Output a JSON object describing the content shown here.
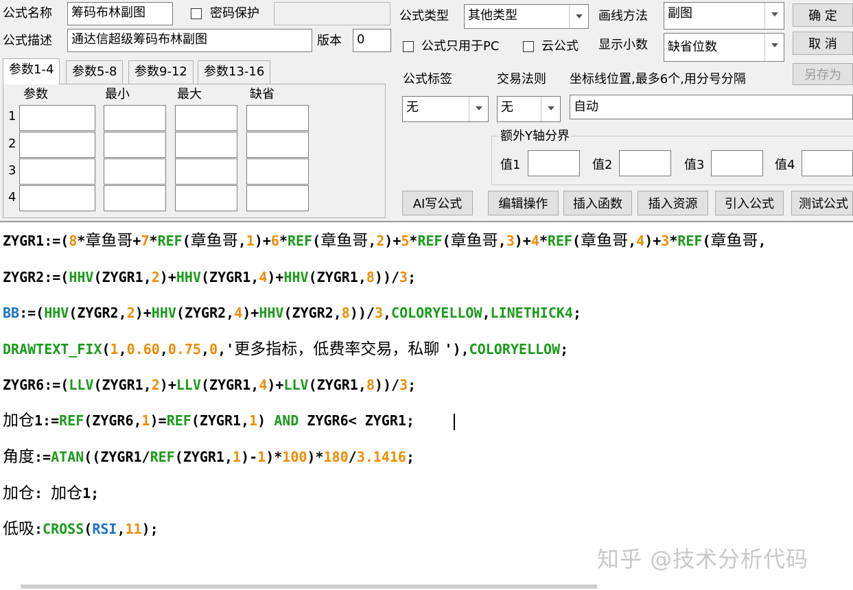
{
  "top": {
    "name_label": "公式名称",
    "name_value": "筹码布林副图",
    "password_label": "密码保护",
    "desc_label": "公式描述",
    "desc_value": "通达信超级筹码布林副图",
    "version_label": "版本",
    "version_value": "0"
  },
  "right": {
    "type_label": "公式类型",
    "type_value": "其他类型",
    "draw_label": "画线方法",
    "draw_value": "副图",
    "pc_only_label": "公式只用于PC",
    "cloud_label": "云公式",
    "decimal_label": "显示小数",
    "decimal_value": "缺省位数",
    "ok_button": "确 定",
    "cancel_button": "取 消",
    "saveas_button": "另存为",
    "tag_label": "公式标签",
    "tag_value": "无",
    "trade_label": "交易法则",
    "trade_value": "无",
    "axis_label": "坐标线位置,最多6个,用分号分隔",
    "axis_value": "自动",
    "extra_y_label": "额外Y轴分界",
    "val1": "值1",
    "val2": "值2",
    "val3": "值3",
    "val4": "值4"
  },
  "tabs": [
    "参数1-4",
    "参数5-8",
    "参数9-12",
    "参数13-16"
  ],
  "params": {
    "headers": [
      "参数",
      "最小",
      "最大",
      "缺省"
    ],
    "rows": [
      "1",
      "2",
      "3",
      "4"
    ]
  },
  "actions": {
    "ai": "AI写公式",
    "edit": "编辑操作",
    "insert_func": "插入函数",
    "insert_res": "插入资源",
    "import": "引入公式",
    "test": "测试公式"
  },
  "code": {
    "lines": [
      [
        [
          "k",
          "ZYGR1:=("
        ],
        [
          "o",
          "8"
        ],
        [
          "k",
          "*"
        ],
        [
          "cn",
          "章鱼哥"
        ],
        [
          "k",
          "+"
        ],
        [
          "o",
          "7"
        ],
        [
          "k",
          "*"
        ],
        [
          "g",
          "REF"
        ],
        [
          "k",
          "("
        ],
        [
          "cn",
          "章鱼哥"
        ],
        [
          "k",
          ","
        ],
        [
          "o",
          "1"
        ],
        [
          "k",
          ")+"
        ],
        [
          "o",
          "6"
        ],
        [
          "k",
          "*"
        ],
        [
          "g",
          "REF"
        ],
        [
          "k",
          "("
        ],
        [
          "cn",
          "章鱼哥"
        ],
        [
          "k",
          ","
        ],
        [
          "o",
          "2"
        ],
        [
          "k",
          ")+"
        ],
        [
          "o",
          "5"
        ],
        [
          "k",
          "*"
        ],
        [
          "g",
          "REF"
        ],
        [
          "k",
          "("
        ],
        [
          "cn",
          "章鱼哥"
        ],
        [
          "k",
          ","
        ],
        [
          "o",
          "3"
        ],
        [
          "k",
          ")+"
        ],
        [
          "o",
          "4"
        ],
        [
          "k",
          "*"
        ],
        [
          "g",
          "REF"
        ],
        [
          "k",
          "("
        ],
        [
          "cn",
          "章鱼哥"
        ],
        [
          "k",
          ","
        ],
        [
          "o",
          "4"
        ],
        [
          "k",
          ")+"
        ],
        [
          "o",
          "3"
        ],
        [
          "k",
          "*"
        ],
        [
          "g",
          "REF"
        ],
        [
          "k",
          "("
        ],
        [
          "cn",
          "章鱼哥"
        ],
        [
          "k",
          ","
        ]
      ],
      [
        [
          "k",
          "ZYGR2:=("
        ],
        [
          "g",
          "HHV"
        ],
        [
          "k",
          "(ZYGR1,"
        ],
        [
          "o",
          "2"
        ],
        [
          "k",
          ")+"
        ],
        [
          "g",
          "HHV"
        ],
        [
          "k",
          "(ZYGR1,"
        ],
        [
          "o",
          "4"
        ],
        [
          "k",
          ")+"
        ],
        [
          "g",
          "HHV"
        ],
        [
          "k",
          "(ZYGR1,"
        ],
        [
          "o",
          "8"
        ],
        [
          "k",
          "))/"
        ],
        [
          "o",
          "3"
        ],
        [
          "k",
          ";"
        ]
      ],
      [
        [
          "b",
          "BB"
        ],
        [
          "k",
          ":=("
        ],
        [
          "g",
          "HHV"
        ],
        [
          "k",
          "(ZYGR2,"
        ],
        [
          "o",
          "2"
        ],
        [
          "k",
          ")+"
        ],
        [
          "g",
          "HHV"
        ],
        [
          "k",
          "(ZYGR2,"
        ],
        [
          "o",
          "4"
        ],
        [
          "k",
          ")+"
        ],
        [
          "g",
          "HHV"
        ],
        [
          "k",
          "(ZYGR2,"
        ],
        [
          "o",
          "8"
        ],
        [
          "k",
          "))/"
        ],
        [
          "o",
          "3"
        ],
        [
          "k",
          ","
        ],
        [
          "g",
          "COLORYELLOW"
        ],
        [
          "k",
          ","
        ],
        [
          "g",
          "LINETHICK4"
        ],
        [
          "k",
          ";"
        ]
      ],
      [
        [
          "g",
          "DRAWTEXT_FIX"
        ],
        [
          "k",
          "("
        ],
        [
          "o",
          "1"
        ],
        [
          "k",
          ","
        ],
        [
          "o",
          "0.60"
        ],
        [
          "k",
          ","
        ],
        [
          "o",
          "0.75"
        ],
        [
          "k",
          ","
        ],
        [
          "o",
          "0"
        ],
        [
          "k",
          ",'"
        ],
        [
          "cn",
          "更多指标，低费率交易，私聊 "
        ],
        [
          "k",
          "'),"
        ],
        [
          "g",
          "COLORYELLOW"
        ],
        [
          "k",
          ";"
        ]
      ],
      [
        [
          "k",
          "ZYGR6:=("
        ],
        [
          "g",
          "LLV"
        ],
        [
          "k",
          "(ZYGR1,"
        ],
        [
          "o",
          "2"
        ],
        [
          "k",
          ")+"
        ],
        [
          "g",
          "LLV"
        ],
        [
          "k",
          "(ZYGR1,"
        ],
        [
          "o",
          "4"
        ],
        [
          "k",
          ")+"
        ],
        [
          "g",
          "LLV"
        ],
        [
          "k",
          "(ZYGR1,"
        ],
        [
          "o",
          "8"
        ],
        [
          "k",
          "))/"
        ],
        [
          "o",
          "3"
        ],
        [
          "k",
          ";"
        ]
      ],
      [
        [
          "cn",
          "加仓"
        ],
        [
          "k",
          "1:="
        ],
        [
          "g",
          "REF"
        ],
        [
          "k",
          "(ZYGR6,"
        ],
        [
          "o",
          "1"
        ],
        [
          "k",
          ")="
        ],
        [
          "g",
          "REF"
        ],
        [
          "k",
          "(ZYGR1,"
        ],
        [
          "o",
          "1"
        ],
        [
          "k",
          ") "
        ],
        [
          "g",
          "AND"
        ],
        [
          "k",
          " ZYGR6< ZYGR1;"
        ]
      ],
      [
        [
          "cn",
          "角度"
        ],
        [
          "k",
          ":="
        ],
        [
          "g",
          "ATAN"
        ],
        [
          "k",
          "((ZYGR1/"
        ],
        [
          "g",
          "REF"
        ],
        [
          "k",
          "(ZYGR1,"
        ],
        [
          "o",
          "1"
        ],
        [
          "k",
          ")-"
        ],
        [
          "o",
          "1"
        ],
        [
          "k",
          ")*"
        ],
        [
          "o",
          "100"
        ],
        [
          "k",
          ")*"
        ],
        [
          "o",
          "180"
        ],
        [
          "k",
          "/"
        ],
        [
          "o",
          "3.1416"
        ],
        [
          "k",
          ";"
        ]
      ],
      [
        [
          "cn",
          "加仓"
        ],
        [
          "k",
          ": "
        ],
        [
          "cn",
          "加仓"
        ],
        [
          "k",
          "1;"
        ]
      ],
      [
        [
          "cn",
          "低吸"
        ],
        [
          "k",
          ":"
        ],
        [
          "g",
          "CROSS"
        ],
        [
          "k",
          "("
        ],
        [
          "b",
          "RSI"
        ],
        [
          "k",
          ","
        ],
        [
          "o",
          "11"
        ],
        [
          "k",
          ");"
        ]
      ]
    ]
  },
  "watermark": "知乎 @技术分析代码"
}
